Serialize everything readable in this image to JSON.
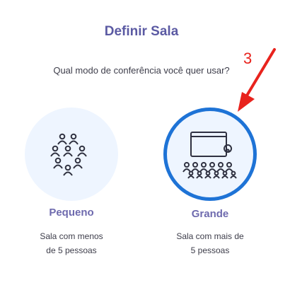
{
  "dialog": {
    "title": "Definir Sala",
    "question": "Qual modo de conferência você quer usar?"
  },
  "options": [
    {
      "label": "Pequeno",
      "description_lines": [
        "Sala com menos",
        "de 5 pessoas"
      ],
      "icon": "small-group-icon",
      "selected": false
    },
    {
      "label": "Grande",
      "description_lines": [
        "Sala com mais de",
        "5 pessoas"
      ],
      "icon": "large-room-presentation-icon",
      "selected": true
    }
  ],
  "annotation": {
    "step_number": "3",
    "color": "#e8231d"
  },
  "colors": {
    "accent": "#1e73d6",
    "title": "#5b5aa3",
    "circle_bg": "#eef5ff"
  }
}
